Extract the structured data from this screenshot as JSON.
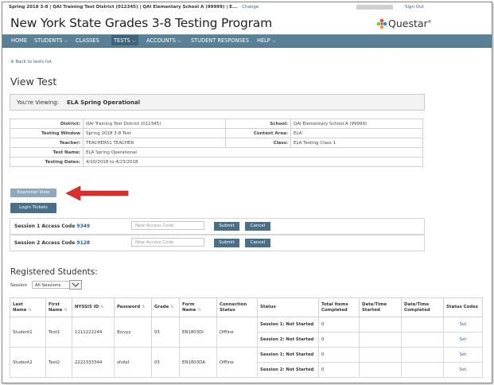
{
  "topbar": {
    "context": "Spring 2018 3-8  |  QAI Training Test District (012345)  |  QAI Elementary School A (99999)  |  E...",
    "change_label": "Change",
    "signout_label": "Sign Out"
  },
  "header": {
    "title": "New York State Grades 3-8 Testing Program",
    "logo_text": "Questar",
    "logo_mark": "®"
  },
  "nav": {
    "items": [
      {
        "label": "HOME"
      },
      {
        "label": "STUDENTS ⌵"
      },
      {
        "label": "CLASSES"
      },
      {
        "label": "TESTS ⌵"
      },
      {
        "label": "ACCOUNTS ⌵"
      },
      {
        "label": "STUDENT RESPONSES"
      },
      {
        "label": "HELP ⌵"
      }
    ]
  },
  "content": {
    "back_link": "⊛ Back to tests list",
    "page_title": "View Test",
    "viewing_label": "You're Viewing:",
    "viewing_value": "ELA Spring Operational",
    "info": {
      "district_label": "District:",
      "district_value": "QAI Training Test District (012345)",
      "school_label": "School:",
      "school_value": "QAI Elementary School A (99999)",
      "window_label": "Testing Window",
      "window_value": "Spring 2018 3-8 Test",
      "content_label": "Content Area:",
      "content_value": "ELA",
      "teacher_label": "Teacher:",
      "teacher_value": "TEACHER51 TEACHER",
      "class_label": "Class:",
      "class_value": "ELA Testing Class 1",
      "testname_label": "Test Name:",
      "testname_value": "ELA Spring Operational",
      "dates_label": "Testing Dates:",
      "dates_value": "4/10/2018 to 4/23/2018"
    },
    "examiner_button": "Examiner View",
    "login_button": "Login Tickets",
    "sessions": [
      {
        "label": "Session 1 Access Code",
        "code": "9349",
        "placeholder": "New Access Code",
        "submit": "Submit",
        "cancel": "Cancel"
      },
      {
        "label": "Session 2 Access Code",
        "code": "9128",
        "placeholder": "New Access Code",
        "submit": "Submit",
        "cancel": "Cancel"
      }
    ],
    "registered_title": "Registered Students:",
    "session_filter_label": "Session",
    "session_filter_value": "All Sessions"
  },
  "table": {
    "headers": {
      "last": "Last Name",
      "first": "First Name",
      "nysis": "NYSSIS ID",
      "password": "Password",
      "grade": "Grade",
      "form": "Form Name",
      "connection": "Connection Status",
      "status": "Status",
      "items": "Total Items Completed",
      "started": "Date/Time Started",
      "completed": "Date/Time Completed",
      "codes": "Status Codes"
    },
    "rows": [
      {
        "last": "Student1",
        "first": "Test1",
        "nysis": "1111222244",
        "password": "8jvvyy",
        "grade": "03",
        "form": "EN1803DI",
        "connection": "Offline",
        "s1_status": "Session 1: Not Started",
        "s1_items": "0",
        "s1_set": "Set",
        "s2_status": "Session 2: Not Started",
        "s2_items": "0",
        "s2_set": "Set"
      },
      {
        "last": "Student2",
        "first": "Test2",
        "nysis": "2222333344",
        "password": "sfufaf",
        "grade": "03",
        "form": "EN1803DA",
        "connection": "Offline",
        "s1_status": "Session 1: Not Started",
        "s1_items": "0",
        "s1_set": "Set",
        "s2_status": "Session 2: Not Started",
        "s2_items": "0",
        "s2_set": "Set"
      }
    ]
  },
  "colors": {
    "nav_bg": "#5a8097",
    "button_bg": "#4a7089",
    "link": "#2f5f9a",
    "arrow": "#d9302f"
  }
}
